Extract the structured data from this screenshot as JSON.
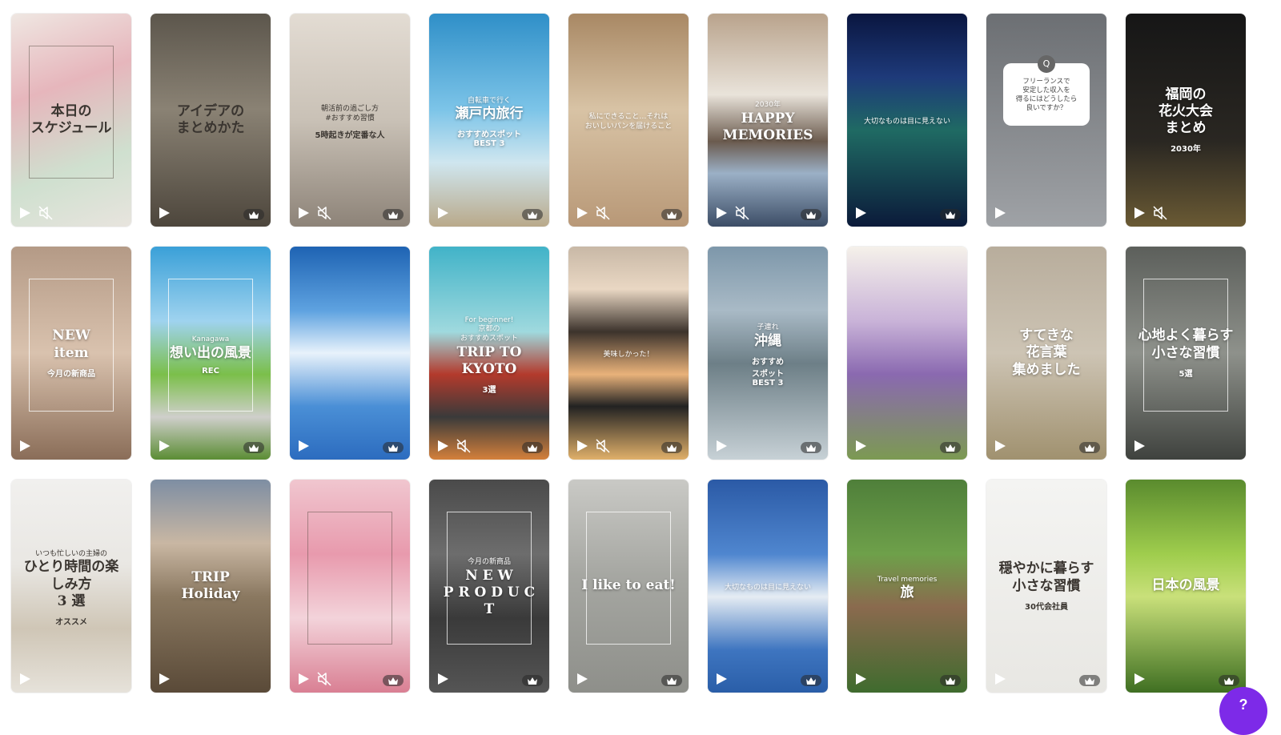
{
  "grid": {
    "templates": [
      {
        "bg": "linear-gradient(160deg,#efe7e2 0%,#e6b6bc 35%,#cfe0cf 70%,#e8e4de 100%)",
        "title": "本日の\nスケジュール",
        "subtitle": "",
        "badge": "",
        "tone": "dark",
        "muted": true,
        "premium": false,
        "frame": true
      },
      {
        "bg": "linear-gradient(180deg,#5c564c 0%,#8a8274 45%,#4d463c 100%)",
        "title": "アイデアの\nまとめかた",
        "subtitle": "",
        "badge": "",
        "tone": "dark",
        "muted": false,
        "premium": true,
        "frame": false
      },
      {
        "bg": "linear-gradient(180deg,#e3dcd3 0%,#c9c1b6 50%,#8d8378 100%)",
        "title": "",
        "subtitle": "朝活前の過ごし方\n#おすすめ習慣",
        "badge": "5時起きが定番な人",
        "tone": "dark",
        "muted": true,
        "premium": true,
        "frame": false
      },
      {
        "bg": "linear-gradient(180deg,#2f8fc8 0%,#7cc4e8 45%,#cfe6ef 70%,#b9a98a 100%)",
        "title": "瀬戸内旅行",
        "subtitle": "自転車で行く",
        "badge": "おすすめスポット\nBEST 3",
        "tone": "light",
        "muted": false,
        "premium": true,
        "frame": false
      },
      {
        "bg": "linear-gradient(180deg,#a88864 0%,#d8c3a5 45%,#b89877 100%)",
        "title": "",
        "subtitle": "私にできること…それは\nおいしいパンを届けること",
        "badge": "",
        "tone": "light",
        "muted": true,
        "premium": true,
        "frame": false
      },
      {
        "bg": "linear-gradient(180deg,#b9a38c 0%,#e9e3da 38%,#6b5b4e 60%,#9bb0c6 75%,#3c4d66 100%)",
        "title": "HAPPY\nMEMORIES",
        "subtitle": "2030年",
        "badge": "",
        "tone": "light",
        "muted": true,
        "premium": true,
        "frame": false
      },
      {
        "bg": "linear-gradient(180deg,#0a1640 0%,#1e3a7a 30%,#1f6a63 55%,#0b1a3a 100%)",
        "title": "",
        "subtitle": "大切なものは目に見えない",
        "badge": "",
        "tone": "light",
        "muted": false,
        "premium": true,
        "frame": false
      },
      {
        "bg": "linear-gradient(180deg,#6c6f73 0%,#9fa2a6 100%)",
        "title": "",
        "subtitle": "フリーランスで\n安定した収入を\n得るにはどうしたら\n良いですか？",
        "badge": "Q",
        "tone": "dark",
        "muted": false,
        "premium": false,
        "frame": false,
        "bubble": true
      },
      {
        "bg": "linear-gradient(180deg,#161616 0%,#2a2722 60%,#6a5a34 100%)",
        "title": "福岡の\n花火大会\nまとめ",
        "subtitle": "",
        "badge": "2030年",
        "tone": "light",
        "muted": true,
        "premium": false,
        "frame": false
      },
      {
        "bg": "linear-gradient(180deg,#b49a86 0%,#d9c2ae 50%,#8a6d58 100%)",
        "title": "NEW\nitem",
        "subtitle": "",
        "badge": "今月の新商品",
        "tone": "light",
        "muted": false,
        "premium": false,
        "frame": true
      },
      {
        "bg": "linear-gradient(180deg,#3aa0d8 0%,#9fd3ef 35%,#7bbf4a 60%,#cfcfcb 80%,#5b8d34 100%)",
        "title": "想い出の風景",
        "subtitle": "Kanagawa",
        "badge": "REC",
        "tone": "light",
        "muted": false,
        "premium": true,
        "frame": true
      },
      {
        "bg": "linear-gradient(180deg,#1e63b3 0%,#5ea2e0 30%,#e8f2fb 50%,#4a8fd6 75%,#2c6cbf 100%)",
        "title": "",
        "subtitle": "",
        "badge": "",
        "tone": "light",
        "muted": false,
        "premium": true,
        "frame": false
      },
      {
        "bg": "linear-gradient(180deg,#41b3c8 0%,#9fd9de 40%,#b33a2c 60%,#3a3a3a 80%,#d4803b 100%)",
        "title": "TRIP TO\nKYOTO",
        "subtitle": "For beginner!\n京都の\nおすすめスポット",
        "badge": "3選",
        "tone": "light",
        "muted": true,
        "premium": true,
        "frame": false
      },
      {
        "bg": "linear-gradient(180deg,#c8b8a6 0%,#e9d7c3 20%,#3c332c 40%,#e9b27a 60%,#222 75%,#e0b06a 100%)",
        "title": "",
        "subtitle": "美味しかった！",
        "badge": "",
        "tone": "light",
        "muted": true,
        "premium": true,
        "frame": false
      },
      {
        "bg": "linear-gradient(180deg,#7d97aa 0%,#a9bac6 30%,#6d7f87 55%,#c7d1d6 100%)",
        "title": "沖縄",
        "subtitle": "子連れ",
        "badge": "おすすめ\nスポット\nBEST 3",
        "tone": "light",
        "muted": false,
        "premium": true,
        "frame": false
      },
      {
        "bg": "linear-gradient(180deg,#f5f1ea 0%,#c9b3d8 35%,#8a69b0 60%,#7c9a52 100%)",
        "title": "",
        "subtitle": "",
        "badge": "",
        "tone": "light",
        "muted": false,
        "premium": true,
        "frame": false
      },
      {
        "bg": "linear-gradient(180deg,#b8ad9c 0%,#cdc4b4 50%,#a0916f 100%)",
        "title": "すてきな\n花言葉\n集めました",
        "subtitle": "",
        "badge": "",
        "tone": "light",
        "muted": false,
        "premium": true,
        "frame": false
      },
      {
        "bg": "linear-gradient(180deg,#5c5f5b 0%,#8e918b 50%,#3f423e 100%)",
        "title": "心地よく暮らす\n小さな習慣",
        "subtitle": "",
        "badge": "5選",
        "tone": "light",
        "muted": false,
        "premium": false,
        "frame": true
      },
      {
        "bg": "linear-gradient(180deg,#f1f0ee 0%,#e9e7e3 40%,#cfc6b6 70%,#e6e2da 100%)",
        "title": "ひとり時間の楽しみ方\n3 選",
        "subtitle": "いつも忙しいの主婦の",
        "badge": "オススメ",
        "tone": "dark",
        "muted": false,
        "premium": false,
        "frame": false
      },
      {
        "bg": "linear-gradient(180deg,#7e8ea3 0%,#c9b7a3 30%,#8a7860 55%,#5a4a38 100%)",
        "title": "TRIP\nHoliday",
        "subtitle": "",
        "badge": "",
        "tone": "light",
        "muted": false,
        "premium": false,
        "frame": false
      },
      {
        "bg": "linear-gradient(180deg,#f0c6cf 0%,#e89aad 35%,#f3d3da 65%,#d97f93 100%)",
        "title": "",
        "subtitle": "",
        "badge": "",
        "tone": "dark",
        "muted": true,
        "premium": true,
        "frame": true
      },
      {
        "bg": "linear-gradient(180deg,#4a4a4a 0%,#6d6d6d 35%,#3a3a3a 65%,#555 100%)",
        "title": "N E W\nP R O D U C T",
        "subtitle": "今月の新商品",
        "badge": "",
        "tone": "light",
        "muted": false,
        "premium": true,
        "frame": true
      },
      {
        "bg": "linear-gradient(180deg,#c9c9c5 0%,#a6a7a2 45%,#8e8f8a 100%)",
        "title": "I like to eat!",
        "subtitle": "",
        "badge": "",
        "tone": "light",
        "muted": false,
        "premium": true,
        "frame": true
      },
      {
        "bg": "linear-gradient(180deg,#2b5aa6 0%,#4f86cf 35%,#e5ecf3 55%,#3e75c0 80%,#2a5ea8 100%)",
        "title": "",
        "subtitle": "大切なものは目に見えない",
        "badge": "",
        "tone": "light",
        "muted": false,
        "premium": true,
        "frame": false
      },
      {
        "bg": "linear-gradient(180deg,#4f7f3a 0%,#6ea04a 35%,#8a6a4e 60%,#3f6b2e 100%)",
        "title": "旅",
        "subtitle": "Travel memories",
        "badge": "",
        "tone": "light",
        "muted": false,
        "premium": true,
        "frame": false
      },
      {
        "bg": "linear-gradient(180deg,#f4f4f2 0%,#e8e7e3 100%)",
        "title": "穏やかに暮らす\n小さな習慣",
        "subtitle": "",
        "badge": "30代会社員",
        "tone": "dark",
        "muted": false,
        "premium": true,
        "frame": false
      },
      {
        "bg": "linear-gradient(180deg,#5a8b2e 0%,#9fcd4d 35%,#c9e07a 55%,#3f6f22 100%)",
        "title": "日本の風景",
        "subtitle": "",
        "badge": "",
        "tone": "light",
        "muted": false,
        "premium": true,
        "frame": false
      }
    ]
  },
  "colors": {
    "accent": "#7d2ae8",
    "icon": "#ffffff"
  },
  "fab": {
    "label": "?"
  }
}
